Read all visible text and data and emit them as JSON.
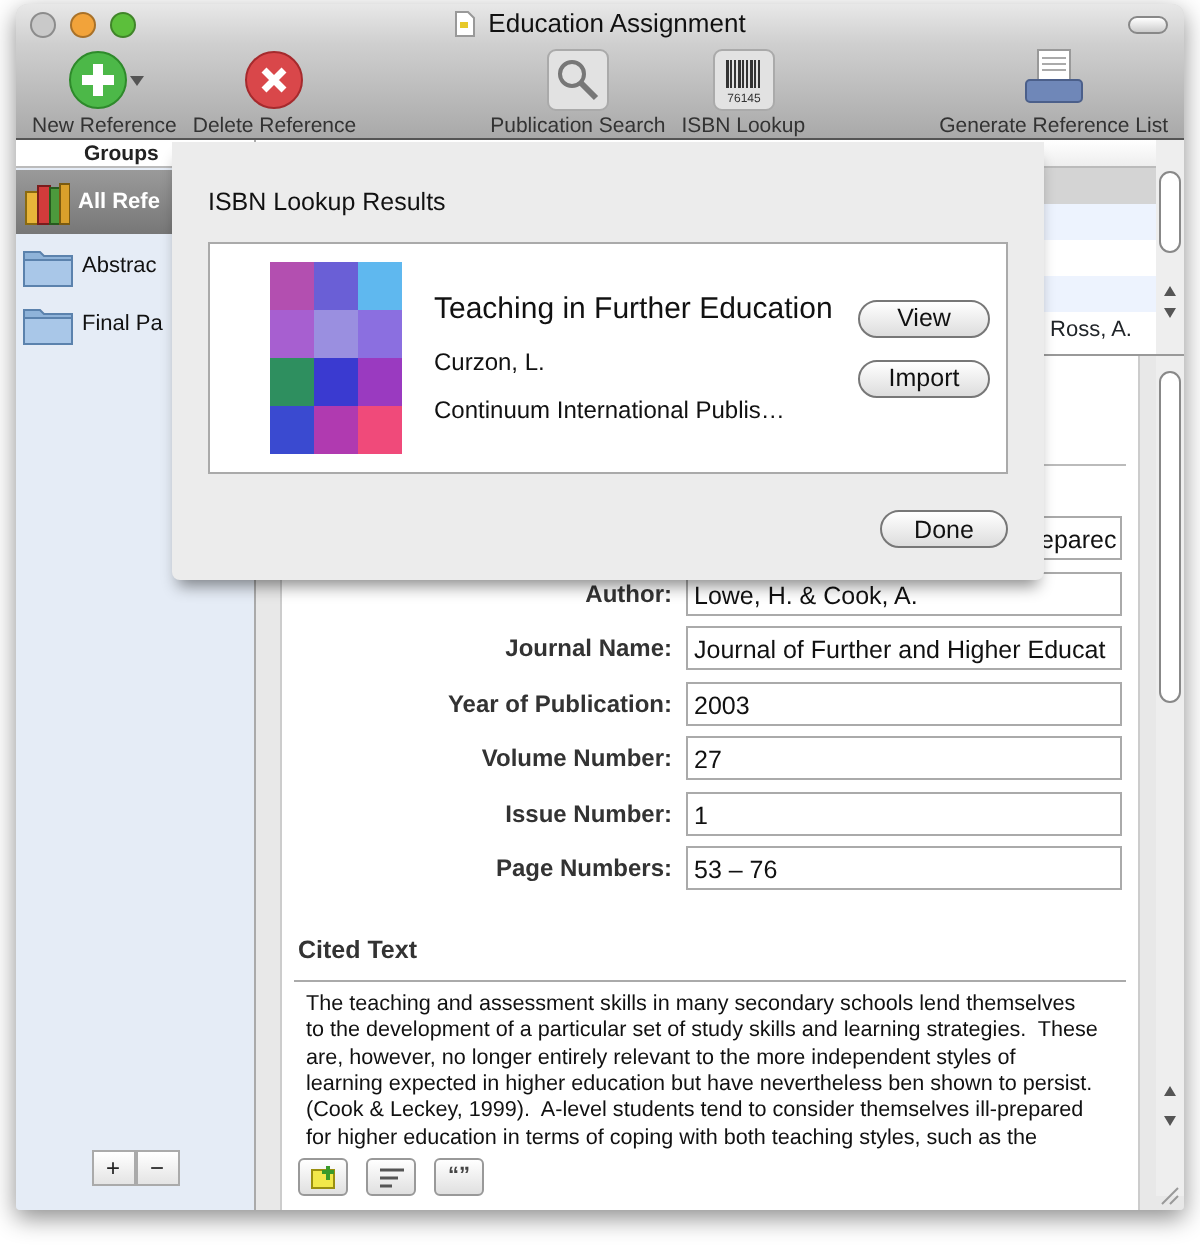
{
  "window": {
    "title": "Education Assignment"
  },
  "toolbar": [
    {
      "label": "New Reference",
      "kind": "new",
      "has_menu": true
    },
    {
      "label": "Delete Reference",
      "kind": "delete",
      "has_menu": false
    },
    {
      "label": "Publication Search",
      "kind": "search",
      "has_menu": false
    },
    {
      "label": "ISBN Lookup",
      "kind": "barcode",
      "has_menu": false,
      "icon_text": "76145"
    },
    {
      "label": "Generate Reference List",
      "kind": "printer",
      "has_menu": false
    }
  ],
  "sidebar": {
    "header": "Groups",
    "items": [
      {
        "label": "All Refe",
        "kind": "library",
        "selected": true
      },
      {
        "label": "Abstrac",
        "kind": "folder",
        "selected": false
      },
      {
        "label": "Final Pa",
        "kind": "folder",
        "selected": false
      }
    ],
    "buttons": [
      "+",
      "−"
    ]
  },
  "references_table": {
    "rows": [
      {
        "selected": true
      },
      {
        "selected": false
      },
      {
        "selected": false
      },
      {
        "selected": false
      },
      {
        "selected": false,
        "author": "Ross, A."
      }
    ]
  },
  "form": {
    "fields": [
      {
        "value": "eparec"
      },
      {
        "label": "Author:",
        "value": "Lowe, H. & Cook, A."
      },
      {
        "label": "Journal Name:",
        "value": "Journal of Further and Higher Educat"
      },
      {
        "label": "Year of Publication:",
        "value": "2003"
      },
      {
        "label": "Volume Number:",
        "value": "27"
      },
      {
        "label": "Issue Number:",
        "value": "1"
      },
      {
        "label": "Page Numbers:",
        "value": "53 – 76"
      }
    ]
  },
  "cited_text": {
    "heading": "Cited Text",
    "lines": [
      "The teaching and assessment skills in many secondary schools lend themselves",
      "to the development of a particular set of study skills and learning strategies.  These",
      "are, however, no longer entirely relevant to the more independent styles of",
      "learning expected in higher education but have nevertheless ben shown to persist.",
      "(Cook & Leckey, 1999).  A-level students tend to consider themselves ill-prepared",
      "for higher education in terms of coping with both teaching styles, such as the"
    ]
  },
  "editor_buttons": [
    {
      "kind": "add-note"
    },
    {
      "kind": "align"
    },
    {
      "kind": "quote",
      "text": "“”"
    }
  ],
  "sheet": {
    "title": "ISBN Lookup Results",
    "result": {
      "title": "Teaching in Further Education",
      "author": "Curzon, L.",
      "publisher": "Continuum International Publis…"
    },
    "buttons": [
      "View",
      "Import"
    ],
    "done": "Done"
  }
}
